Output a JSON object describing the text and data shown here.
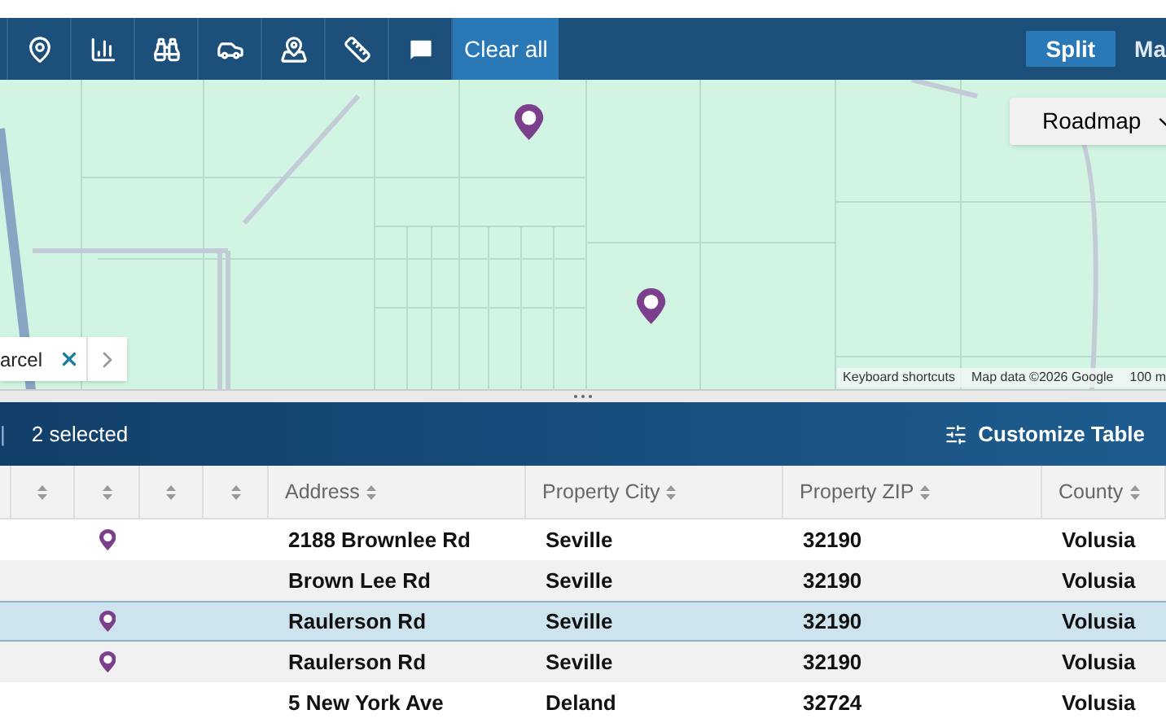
{
  "toolbar": {
    "clear_button": "Clear all",
    "view_tabs": [
      {
        "label": "Split",
        "selected": true
      },
      {
        "label": "Ma",
        "selected": false
      }
    ]
  },
  "map": {
    "map_type": "Roadmap",
    "parcel_control": {
      "label": "arcel"
    },
    "attribution": [
      "Keyboard shortcuts",
      "Map data ©2026 Google",
      "100 m"
    ]
  },
  "table_bar": {
    "separator": "|",
    "selection": "2 selected",
    "customize_button": "Customize Table"
  },
  "table": {
    "columns": [
      {
        "kind": "sort-only"
      },
      {
        "kind": "sort-only"
      },
      {
        "kind": "sort-only"
      },
      {
        "kind": "sort-only"
      },
      {
        "kind": "labeled",
        "label": "Address"
      },
      {
        "kind": "labeled",
        "label": "Property City"
      },
      {
        "kind": "labeled",
        "label": "Property ZIP"
      },
      {
        "kind": "labeled",
        "label": "County"
      }
    ],
    "rows": [
      {
        "pin": true,
        "selected": false,
        "cells": [
          "2188 Brownlee Rd",
          "Seville",
          "32190",
          "Volusia"
        ]
      },
      {
        "pin": false,
        "selected": false,
        "cells": [
          "Brown Lee Rd",
          "Seville",
          "32190",
          "Volusia"
        ]
      },
      {
        "pin": true,
        "selected": true,
        "cells": [
          "Raulerson Rd",
          "Seville",
          "32190",
          "Volusia"
        ]
      },
      {
        "pin": true,
        "selected": false,
        "cells": [
          "Raulerson Rd",
          "Seville",
          "32190",
          "Volusia"
        ]
      },
      {
        "pin": false,
        "selected": false,
        "cells": [
          "5 New York Ave",
          "Deland",
          "32724",
          "Volusia"
        ]
      }
    ]
  }
}
